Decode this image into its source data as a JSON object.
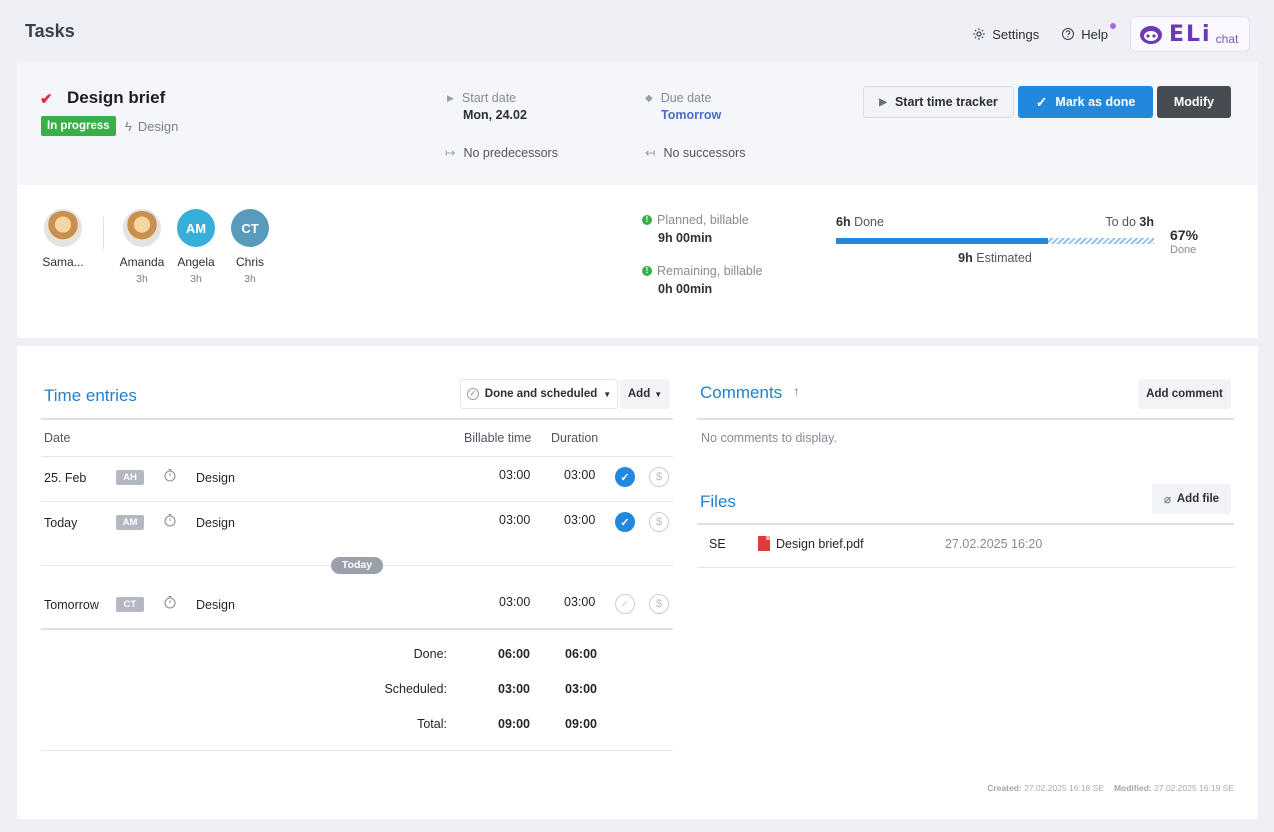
{
  "topbar": {
    "title": "Tasks",
    "settings_label": "Settings",
    "help_label": "Help",
    "eli_logo": "ELi",
    "eli_chat": "chat"
  },
  "task": {
    "title": "Design brief",
    "status": "In progress",
    "type": "Design",
    "start_date_label": "Start date",
    "start_date": "Mon, 24.02",
    "due_date_label": "Due date",
    "due_date": "Tomorrow",
    "predecessors": "No predecessors",
    "successors": "No successors",
    "buttons": {
      "tracker": "Start time tracker",
      "mark_done": "Mark as done",
      "modify": "Modify"
    }
  },
  "team": {
    "owner": {
      "name": "Sama..."
    },
    "members": [
      {
        "name": "Amanda",
        "hours": "3h",
        "initials": ""
      },
      {
        "name": "Angela",
        "hours": "3h",
        "initials": "AM",
        "color": "#36b0d8"
      },
      {
        "name": "Chris",
        "hours": "3h",
        "initials": "CT",
        "color": "#5a9bbd"
      }
    ]
  },
  "stats": {
    "planned_label": "Planned, billable",
    "planned_value": "9h 00min",
    "remaining_label": "Remaining, billable",
    "remaining_value": "0h 00min",
    "done_hours": "6h",
    "done_label": "Done",
    "todo_label": "To do",
    "todo_hours": "3h",
    "estimated_hours": "9h",
    "estimated_label": "Estimated",
    "progress_fraction": 0.667,
    "percent": "67%",
    "percent_label": "Done"
  },
  "time_entries": {
    "title": "Time entries",
    "filter": "Done and scheduled",
    "add": "Add",
    "columns": {
      "date": "Date",
      "billable": "Billable time",
      "duration": "Duration"
    },
    "rows": [
      {
        "date": "25. Feb",
        "initials": "AH",
        "type": "Design",
        "billable": "03:00",
        "duration": "03:00",
        "done": true
      },
      {
        "date": "Today",
        "initials": "AM",
        "type": "Design",
        "billable": "03:00",
        "duration": "03:00",
        "done": true
      },
      {
        "date": "Tomorrow",
        "initials": "CT",
        "type": "Design",
        "billable": "03:00",
        "duration": "03:00",
        "done": false
      }
    ],
    "today_marker": "Today",
    "summary": [
      {
        "label": "Done:",
        "billable": "06:00",
        "duration": "06:00"
      },
      {
        "label": "Scheduled:",
        "billable": "03:00",
        "duration": "03:00"
      },
      {
        "label": "Total:",
        "billable": "09:00",
        "duration": "09:00"
      }
    ]
  },
  "comments": {
    "title": "Comments",
    "add": "Add comment",
    "empty": "No comments to display."
  },
  "files": {
    "title": "Files",
    "add": "Add file",
    "items": [
      {
        "owner": "SE",
        "name": "Design brief.pdf",
        "date": "27.02.2025 16:20"
      }
    ]
  },
  "footer": {
    "created_label": "Created:",
    "created_value": "27.02.2025 16:18 SE",
    "modified_label": "Modified:",
    "modified_value": "27.02.2025 16:19 SE"
  }
}
